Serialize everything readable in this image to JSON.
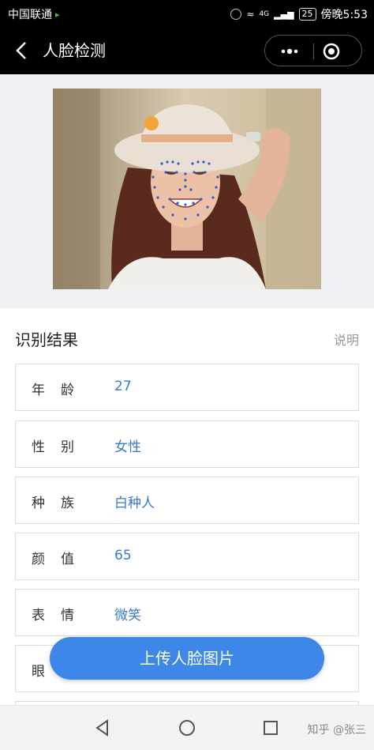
{
  "status_bar": {
    "carrier": "中国联通",
    "battery": "25",
    "time": "傍晚5:53",
    "network": "4G"
  },
  "nav": {
    "title": "人脸检测"
  },
  "results": {
    "title": "识别结果",
    "help": "说明",
    "rows": [
      {
        "label": "年龄",
        "value": "27"
      },
      {
        "label": "性别",
        "value": "女性"
      },
      {
        "label": "种族",
        "value": "白种人"
      },
      {
        "label": "颜值",
        "value": "65"
      },
      {
        "label": "表情",
        "value": "微笑"
      },
      {
        "label": "眼",
        "value": ""
      }
    ]
  },
  "upload_button": "上传人脸图片",
  "watermark": "知乎 @张三",
  "colors": {
    "accent": "#3c87e8",
    "value_text": "#3a79c8",
    "bar": "#000000"
  }
}
